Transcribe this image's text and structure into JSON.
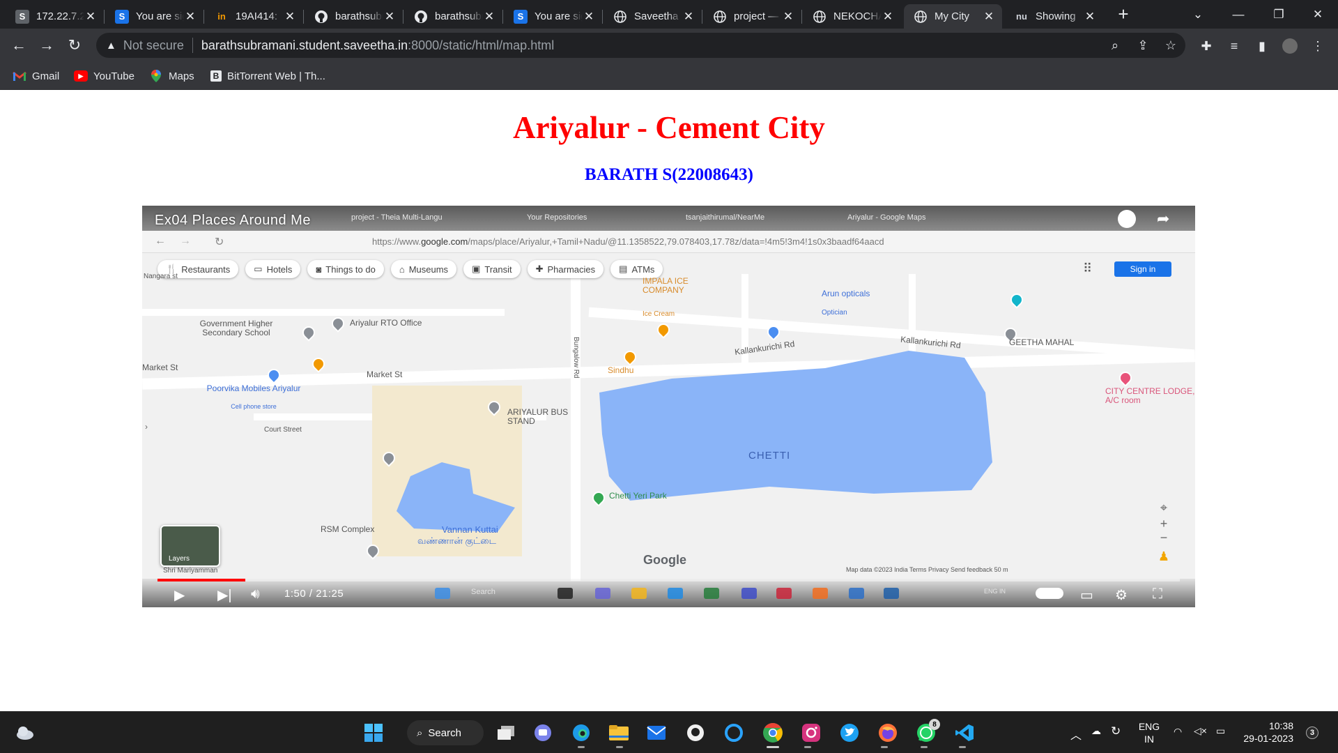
{
  "browser": {
    "tabs": [
      {
        "title": "172.22.7.2",
        "favicon": "s-icon"
      },
      {
        "title": "You are signed",
        "favicon": "s-icon"
      },
      {
        "title": "19AI414: ",
        "favicon": "in-icon"
      },
      {
        "title": "barathsubra",
        "favicon": "github-icon"
      },
      {
        "title": "barathsubra",
        "favicon": "github-icon"
      },
      {
        "title": "You are signed",
        "favicon": "s-icon"
      },
      {
        "title": "Saveetha",
        "favicon": "globe-icon"
      },
      {
        "title": "project — ",
        "favicon": "globe-icon"
      },
      {
        "title": "NEKOCHAN",
        "favicon": "globe-icon"
      },
      {
        "title": "My City",
        "favicon": "globe-icon",
        "active": true
      },
      {
        "title": "Showing",
        "favicon": "nu-icon"
      }
    ],
    "omnibox": {
      "security_label": "Not secure",
      "host": "barathsubramani.student.saveetha.in",
      "path": ":8000/static/html/map.html"
    },
    "bookmarks": [
      {
        "label": "Gmail",
        "icon": "gmail-icon"
      },
      {
        "label": "YouTube",
        "icon": "youtube-icon"
      },
      {
        "label": "Maps",
        "icon": "maps-icon"
      },
      {
        "label": "BitTorrent Web | Th...",
        "icon": "bittorrent-icon"
      }
    ]
  },
  "page": {
    "title": "Ariyalur - Cement City",
    "subtitle": "BARATH S(22008643)"
  },
  "video": {
    "title": "Ex04 Places Around Me",
    "time": "1:50 / 21:25",
    "progress": 0.086,
    "inner_tabs": [
      "project - Theia Multi-Langu",
      "Your Repositories",
      "tsanjaithirumal/NearMe",
      "Ariyalur - Google Maps"
    ],
    "inner_url_prefix": "https://www.",
    "inner_url_host": "google.com",
    "inner_url_rest": "/maps/place/Ariyalur,+Tamil+Nadu/@11.1358522,79.078403,17.78z/data=!4m5!3m4!1s0x3baadf64aacd",
    "map": {
      "chips": [
        "Restaurants",
        "Hotels",
        "Things to do",
        "Museums",
        "Transit",
        "Pharmacies",
        "ATMs"
      ],
      "sign_in": "Sign in",
      "labels": {
        "market_st_left": "Market St",
        "market_st": "Market St",
        "govt_school": "Government Higher Secondary School",
        "rto": "Ariyalur RTO Office",
        "impala": "IMPALA ICE COMPANY",
        "impala_sub": "Ice Cream",
        "arun": "Arun opticals",
        "arun_sub": "Optician",
        "geetha": "GEETHA MAHAL",
        "kallan1": "Kallankurichi Rd",
        "kallan2": "Kallankurichi Rd",
        "poorvika": "Poorvika Mobiles Ariyalur",
        "poorvika_sub": "Cell phone store",
        "bus_stand": "ARIYALUR BUS STAND",
        "sindhu": "Sindhu",
        "city_centre": "CITY CENTRE LODGE, A/C room",
        "court": "Court Street",
        "chetti": "CHETTI",
        "chetti_park": "Chetti Yeri Park",
        "rsm": "RSM Complex",
        "vannan": "Vannan Kuttai",
        "vannan_ta": "வண்ணான் குட்டை",
        "layers": "Layers",
        "google": "Google",
        "footer": "Map data ©2023   India   Terms   Privacy   Send feedback   50 m",
        "nangara": "Nangara st",
        "bungalow": "Bungalow Rd",
        "maryamman": "Shri Mariyamman"
      }
    },
    "taskbar_search": "Search",
    "taskbar_lang": "ENG IN"
  },
  "taskbar": {
    "search_label": "Search",
    "lang_top": "ENG",
    "lang_bottom": "IN",
    "time": "10:38",
    "date": "29-01-2023",
    "notification_count": "3",
    "whatsapp_badge": "8"
  },
  "colors": {
    "title": "#ff0000",
    "subtitle": "#0000ff",
    "water": "#8ab4f8",
    "progress": "#ff0000"
  }
}
